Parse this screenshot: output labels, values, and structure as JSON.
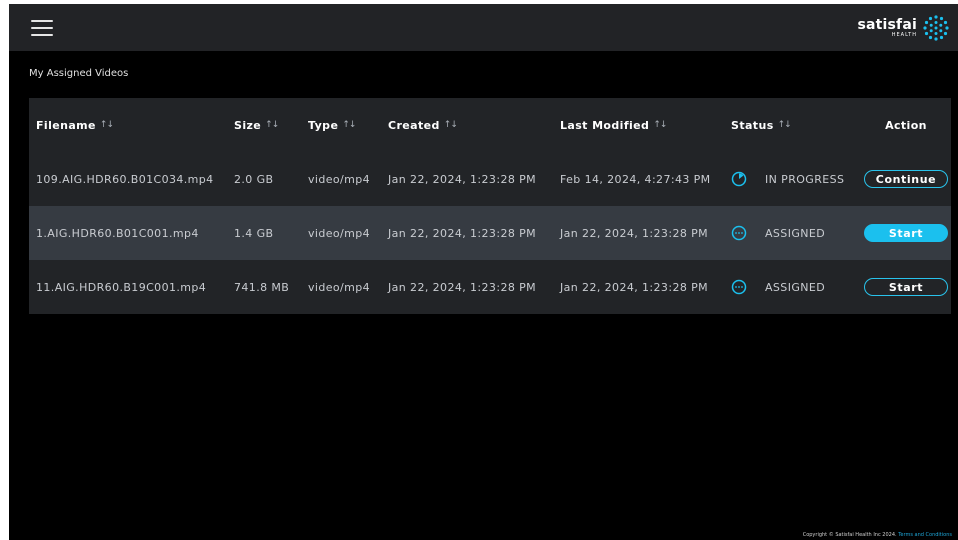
{
  "app": {
    "logo_main": "satisfai",
    "logo_sub": "HEALTH"
  },
  "page": {
    "title": "My Assigned Videos"
  },
  "table": {
    "sort_glyph": "↑↓",
    "columns": {
      "filename": "Filename",
      "size": "Size",
      "type": "Type",
      "created": "Created",
      "modified": "Last Modified",
      "status": "Status",
      "action": "Action"
    },
    "rows": [
      {
        "filename": "109.AIG.HDR60.B01C034.mp4",
        "size": "2.0 GB",
        "type": "video/mp4",
        "created": "Jan 22, 2024, 1:23:28 PM",
        "modified": "Feb 14, 2024, 4:27:43 PM",
        "status": "IN PROGRESS",
        "status_icon": "progress-pie-icon",
        "action": "Continue"
      },
      {
        "filename": "1.AIG.HDR60.B01C001.mp4",
        "size": "1.4 GB",
        "type": "video/mp4",
        "created": "Jan 22, 2024, 1:23:28 PM",
        "modified": "Jan 22, 2024, 1:23:28 PM",
        "status": "ASSIGNED",
        "status_icon": "dots-circle-icon",
        "action": "Start"
      },
      {
        "filename": "11.AIG.HDR60.B19C001.mp4",
        "size": "741.8 MB",
        "type": "video/mp4",
        "created": "Jan 22, 2024, 1:23:28 PM",
        "modified": "Jan 22, 2024, 1:23:28 PM",
        "status": "ASSIGNED",
        "status_icon": "dots-circle-icon",
        "action": "Start"
      }
    ]
  },
  "footer": {
    "copyright": "Copyright © Satisfai Health Inc 2024.",
    "terms_link": "Terms and Conditions"
  },
  "colors": {
    "accent": "#1bc0ee",
    "topbar": "#222326",
    "row_dark": "#222427",
    "row_highlight": "#363b42",
    "background": "#000000"
  }
}
